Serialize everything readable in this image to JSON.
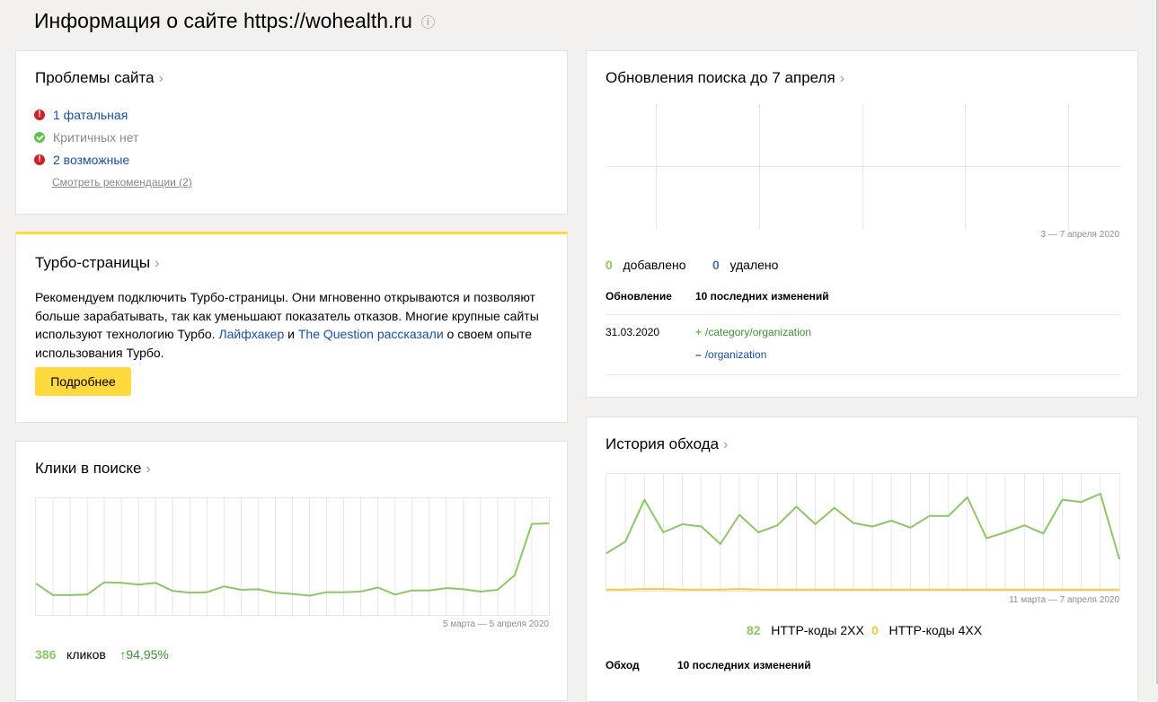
{
  "page": {
    "title": "Информация о сайте https://wohealth.ru",
    "info_icon": "i"
  },
  "problems": {
    "title": "Проблемы сайта",
    "items": [
      {
        "text": "1 фатальная",
        "status": "red"
      },
      {
        "text": "Критичных нет",
        "status": "green"
      },
      {
        "text": "2 возможные",
        "status": "red"
      }
    ],
    "recommend_link": "Смотреть рекомендации (2)"
  },
  "turbo": {
    "title": "Турбо-страницы",
    "text_1": "Рекомендуем подключить Турбо-страницы. Они мгновенно открываются и позволяют больше зарабатывать, так как уменьшают показатель отказов. Многие крупные сайты используют технологию Турбо.",
    "link_1": "Лайфхакер",
    "and": "и",
    "link_2": "The Question",
    "link_3": "рассказали",
    "text_2": "о своем опыте использования Турбо.",
    "button": "Подробнее",
    "accent_color": "#ffd93d"
  },
  "clicks": {
    "title": "Клики в поиске",
    "date_range": "5 марта — 5 апреля 2020",
    "count": "386",
    "count_label": "кликов",
    "change": "↑94,95%",
    "line_color": "#8dc668",
    "chart_data": {
      "type": "line",
      "series": [
        {
          "values": [
            27,
            17,
            17,
            17.5,
            28,
            27.5,
            26,
            27.5,
            20.5,
            19,
            19.5,
            24.5,
            21.5,
            22,
            19,
            18,
            16.5,
            19.5,
            19.5,
            20,
            23.5,
            17.5,
            21,
            21,
            23,
            22,
            20,
            21.5,
            34,
            78,
            78.5
          ]
        }
      ],
      "ylim": [
        0,
        100
      ],
      "grid": true
    }
  },
  "updates": {
    "title": "Обновления поиска до 7 апреля",
    "date_range": "3 — 7 апреля 2020",
    "added_count": "0",
    "added_label": "добавлено",
    "removed_count": "0",
    "removed_label": "удалено",
    "col_update": "Обновление",
    "col_changes": "10 последних изменений",
    "row_date": "31.03.2020",
    "added_path": "/category/organization",
    "removed_path": "/organization"
  },
  "crawl": {
    "title": "История обхода",
    "date_range": "11 марта — 7 апреля 2020",
    "count_2xx": "82",
    "label_2xx": "HTTP-коды 2XX",
    "count_4xx": "0",
    "label_4xx": "HTTP-коды 4XX",
    "col_crawl": "Обход",
    "col_changes": "10 последних изменений",
    "colors": {
      "2xx": "#8dc668",
      "4xx": "#f5c842"
    },
    "chart_data": {
      "type": "line",
      "series": [
        {
          "name": "HTTP-коды 2XX",
          "values": [
            32,
            42,
            78,
            50,
            57,
            55,
            40,
            65,
            50,
            56,
            72,
            57,
            71,
            58,
            55,
            60,
            54,
            64,
            64,
            80,
            45,
            50,
            56,
            49,
            78,
            76,
            83,
            27
          ]
        },
        {
          "name": "HTTP-коды 4XX",
          "values": [
            1,
            1,
            1.5,
            1.5,
            1,
            1,
            1,
            1.5,
            1,
            1,
            1,
            1,
            1,
            1,
            1,
            1,
            1,
            1,
            1,
            1,
            1,
            1,
            1,
            1,
            1,
            1,
            1,
            1
          ]
        }
      ],
      "ylim": [
        0,
        100
      ],
      "grid": true
    }
  }
}
